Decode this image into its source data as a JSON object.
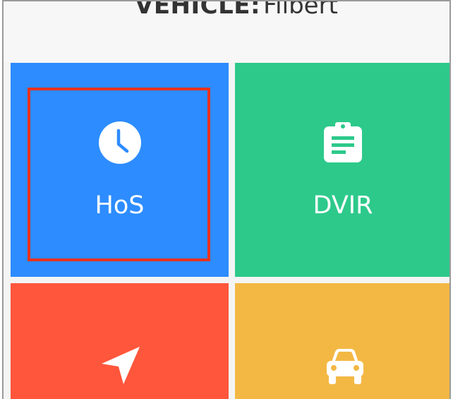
{
  "header": {
    "vehicle_label": "VEHICLE:",
    "vehicle_name": "Filbert"
  },
  "tiles": [
    {
      "label": "HoS",
      "icon": "clock-icon",
      "color": "#2d8cff"
    },
    {
      "label": "DVIR",
      "icon": "clipboard-icon",
      "color": "#2dc98b"
    },
    {
      "label": "",
      "icon": "navigation-icon",
      "color": "#ff563c"
    },
    {
      "label": "",
      "icon": "car-icon",
      "color": "#f3b844"
    }
  ],
  "highlight_color": "#e8321e"
}
